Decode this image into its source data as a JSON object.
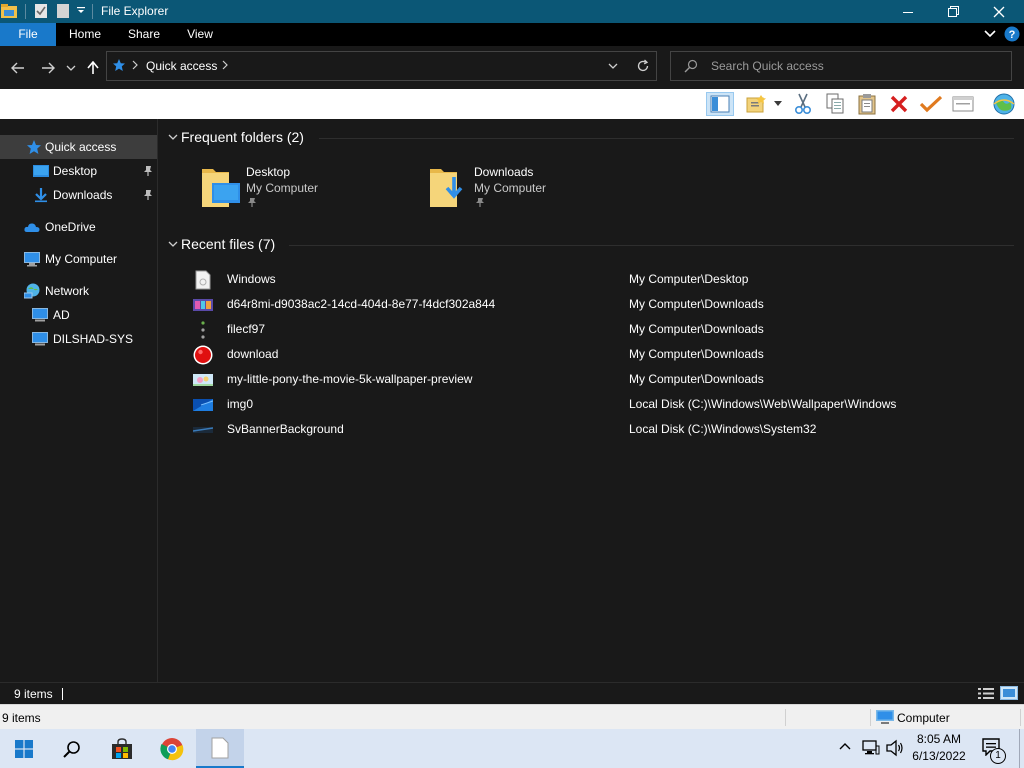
{
  "window": {
    "title": "File Explorer"
  },
  "ribbon": {
    "tabs": [
      "File",
      "Home",
      "Share",
      "View"
    ]
  },
  "address": {
    "location": "Quick access",
    "search_placeholder": "Search Quick access"
  },
  "nav": {
    "items": [
      {
        "label": "Quick access",
        "icon": "star-icon"
      },
      {
        "label": "Desktop",
        "icon": "desktop-folder-icon",
        "pinned": true
      },
      {
        "label": "Downloads",
        "icon": "download-arrow-icon",
        "pinned": true
      },
      {
        "label": "OneDrive",
        "icon": "cloud-icon"
      },
      {
        "label": "My Computer",
        "icon": "computer-icon"
      },
      {
        "label": "Network",
        "icon": "network-icon"
      },
      {
        "label": "AD",
        "icon": "computer-icon"
      },
      {
        "label": "DILSHAD-SYS",
        "icon": "computer-icon"
      }
    ]
  },
  "frequent": {
    "header": "Frequent folders (2)",
    "folders": [
      {
        "name": "Desktop",
        "location": "My Computer"
      },
      {
        "name": "Downloads",
        "location": "My Computer"
      }
    ]
  },
  "recent": {
    "header": "Recent files (7)",
    "files": [
      {
        "name": "Windows",
        "path": "My Computer\\Desktop",
        "icon": "document-icon"
      },
      {
        "name": "d64r8mi-d9038ac2-14cd-404d-8e77-f4dcf302a844",
        "path": "My Computer\\Downloads",
        "icon": "image-thumbnail-icon"
      },
      {
        "name": "filecf97",
        "path": "My Computer\\Downloads",
        "icon": "dots-icon"
      },
      {
        "name": "download",
        "path": "My Computer\\Downloads",
        "icon": "red-circle-icon"
      },
      {
        "name": "my-little-pony-the-movie-5k-wallpaper-preview",
        "path": "My Computer\\Downloads",
        "icon": "image-thumbnail-icon"
      },
      {
        "name": "img0",
        "path": "Local Disk (C:)\\Windows\\Web\\Wallpaper\\Windows",
        "icon": "blue-wallpaper-icon"
      },
      {
        "name": "SvBannerBackground",
        "path": "Local Disk (C:)\\Windows\\System32",
        "icon": "banner-image-icon"
      }
    ]
  },
  "status": {
    "item_count": "9 items"
  },
  "outer_status": {
    "item_count": "9 items",
    "zone": "Computer"
  },
  "taskbar": {
    "time": "8:05 AM",
    "date": "6/13/2022",
    "notification_count": "1"
  },
  "colors": {
    "titlebar": "#0b5776",
    "file_tab": "#1979ca",
    "background": "#191919",
    "taskbar": "#dce6f4"
  }
}
